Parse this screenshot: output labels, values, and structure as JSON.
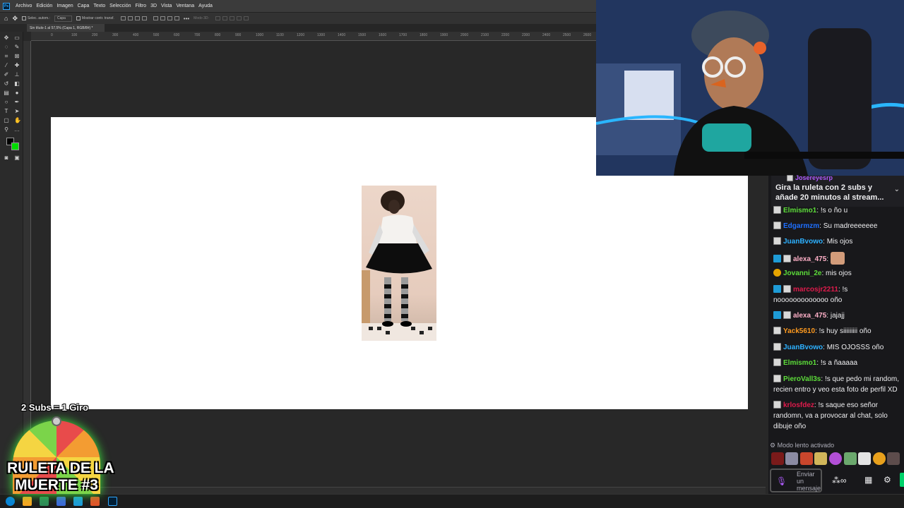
{
  "menubar": {
    "app_icon": "photoshop-logo",
    "items": [
      "Archivo",
      "Edición",
      "Imagen",
      "Capa",
      "Texto",
      "Selección",
      "Filtro",
      "3D",
      "Vista",
      "Ventana",
      "Ayuda"
    ]
  },
  "options_bar": {
    "auto_select_label": "Selec. autom.:",
    "layer_select_value": "Capa",
    "show_transform_label": "Mostrar contr. transf.",
    "mode_3d_label": "Modo 3D:"
  },
  "document": {
    "tab_title": "Sin título-1 al 57,5% (Capa 1, RGB/8#) *"
  },
  "ruler": {
    "labels": [
      "0",
      "100",
      "200",
      "300",
      "400",
      "500",
      "600",
      "700",
      "800",
      "900",
      "1000",
      "1100",
      "1200",
      "1300",
      "1400",
      "1500",
      "1600",
      "1700",
      "1800",
      "1900",
      "2000",
      "2100",
      "2200",
      "2300",
      "2400",
      "2500",
      "2600"
    ]
  },
  "colors": {
    "foreground": "#000000",
    "background": "#00dd00",
    "twitch_purple": "#9147ff"
  },
  "chat": {
    "pinned": {
      "user": "Josereyesrp",
      "user_color": "#b05cff",
      "text": "Gira la ruleta con 2 subs y añade 20 minutos al stream..."
    },
    "messages": [
      {
        "badge": "gray",
        "user": "Elmismo1",
        "color": "#5dde3a",
        "text": "!s o ño u"
      },
      {
        "badge": "gray",
        "user": "Edgarmzm",
        "color": "#1e6fff",
        "text": "Su madreeeeeee"
      },
      {
        "badge": "gray",
        "user": "JuanBvowo",
        "color": "#2db1ff",
        "text": "Mis ojos"
      },
      {
        "badge": "blue2",
        "user": "alexa_475",
        "color": "#ffb0c8",
        "text": ""
      },
      {
        "badge": "gold",
        "user": "Jovanni_2e",
        "color": "#5dde3a",
        "text": "mis ojos"
      },
      {
        "badge": "blue2",
        "user": "marcosjr2211",
        "color": "#e01b4c",
        "text": "!s nooooooooooooo oño"
      },
      {
        "badge": "blue2",
        "user": "alexa_475",
        "color": "#ffb0c8",
        "text": "jajajj"
      },
      {
        "badge": "gray",
        "user": "Yack5610",
        "color": "#ff9a1f",
        "text": "!s huy siiiiiiiii oño"
      },
      {
        "badge": "gray",
        "user": "JuanBvowo",
        "color": "#2db1ff",
        "text": "MIS OJOSSS oño"
      },
      {
        "badge": "gray",
        "user": "Elmismo1",
        "color": "#5dde3a",
        "text": "!s a ñaaaaa"
      },
      {
        "badge": "gray",
        "user": "PieroVall3s",
        "color": "#5dde3a",
        "text": "!s que pedo mi random, recien entro y veo esta foto de perfil XD"
      },
      {
        "badge": "gray",
        "user": "krlosfdez",
        "color": "#e01b4c",
        "text": "!s saque eso señor randomn, va a provocar al chat, solo dibuje oño"
      }
    ],
    "slow_mode": "Modo lento activado",
    "input_placeholder": "Enviar un mensaje"
  },
  "overlay": {
    "subs_text": "2 Subs = 1 Giro",
    "title_line1": "RULETA DE LA",
    "title_line2": "MUERTE #3"
  }
}
